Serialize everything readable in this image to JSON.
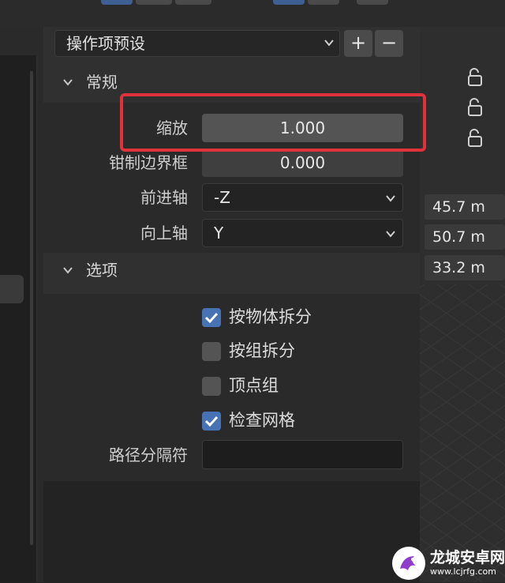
{
  "preset": {
    "label": "操作项预设",
    "add_label": "+",
    "remove_label": "−"
  },
  "general": {
    "title": "常规",
    "scale_label": "缩放",
    "scale_value": "1.000",
    "clamp_label": "钳制边界框",
    "clamp_value": "0.000",
    "forward_label": "前进轴",
    "forward_value": "-Z",
    "up_label": "向上轴",
    "up_value": "Y"
  },
  "options": {
    "title": "选项",
    "items": [
      {
        "label": "按物体拆分",
        "checked": true
      },
      {
        "label": "按组拆分",
        "checked": false
      },
      {
        "label": "顶点组",
        "checked": false
      },
      {
        "label": "检查网格",
        "checked": true
      }
    ],
    "path_separator_label": "路径分隔符",
    "path_separator_value": ""
  },
  "viewport": {
    "dimensions": [
      "45.7 m",
      "50.7 m",
      "33.2 m"
    ]
  },
  "watermark": {
    "name": "龙城安卓网",
    "url": "www.lcjrfg.com"
  },
  "colors": {
    "accent": "#4772b3",
    "highlight": "#e0323a"
  }
}
